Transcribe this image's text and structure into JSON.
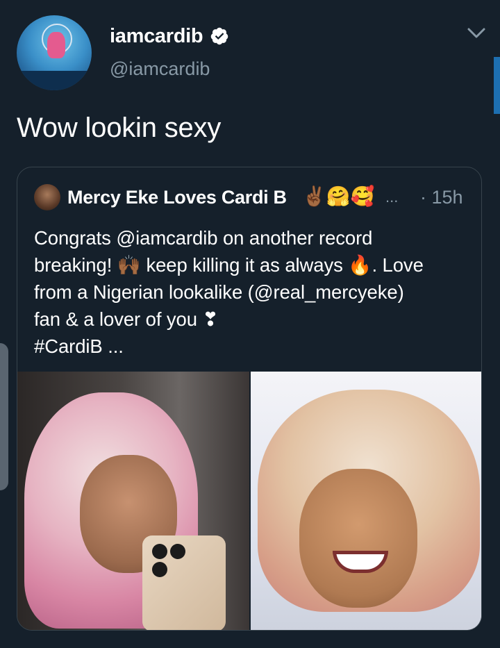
{
  "tweet": {
    "display_name": "iamcardib",
    "handle": "@iamcardib",
    "text": "Wow lookin sexy",
    "verified": true
  },
  "quote": {
    "author_name": "Mercy Eke Loves Cardi B",
    "author_emoji": "✌🏾🤗🥰",
    "name_ellipsis": "...",
    "time": "· 15h",
    "lines": [
      "Congrats @iamcardib on another record",
      "breaking! 🙌🏾 keep killing it as always 🔥. Love",
      "from a Nigerian lookalike (@real_mercyeke)",
      "fan & a lover of you ❣",
      "#CardiB ..."
    ]
  },
  "icons": {
    "verified": "verified-badge-icon",
    "menu": "chevron-down-icon"
  },
  "colors": {
    "background": "#15202b",
    "secondary_text": "#8899a6",
    "border": "#38444d",
    "accent": "#1d9bf0"
  }
}
